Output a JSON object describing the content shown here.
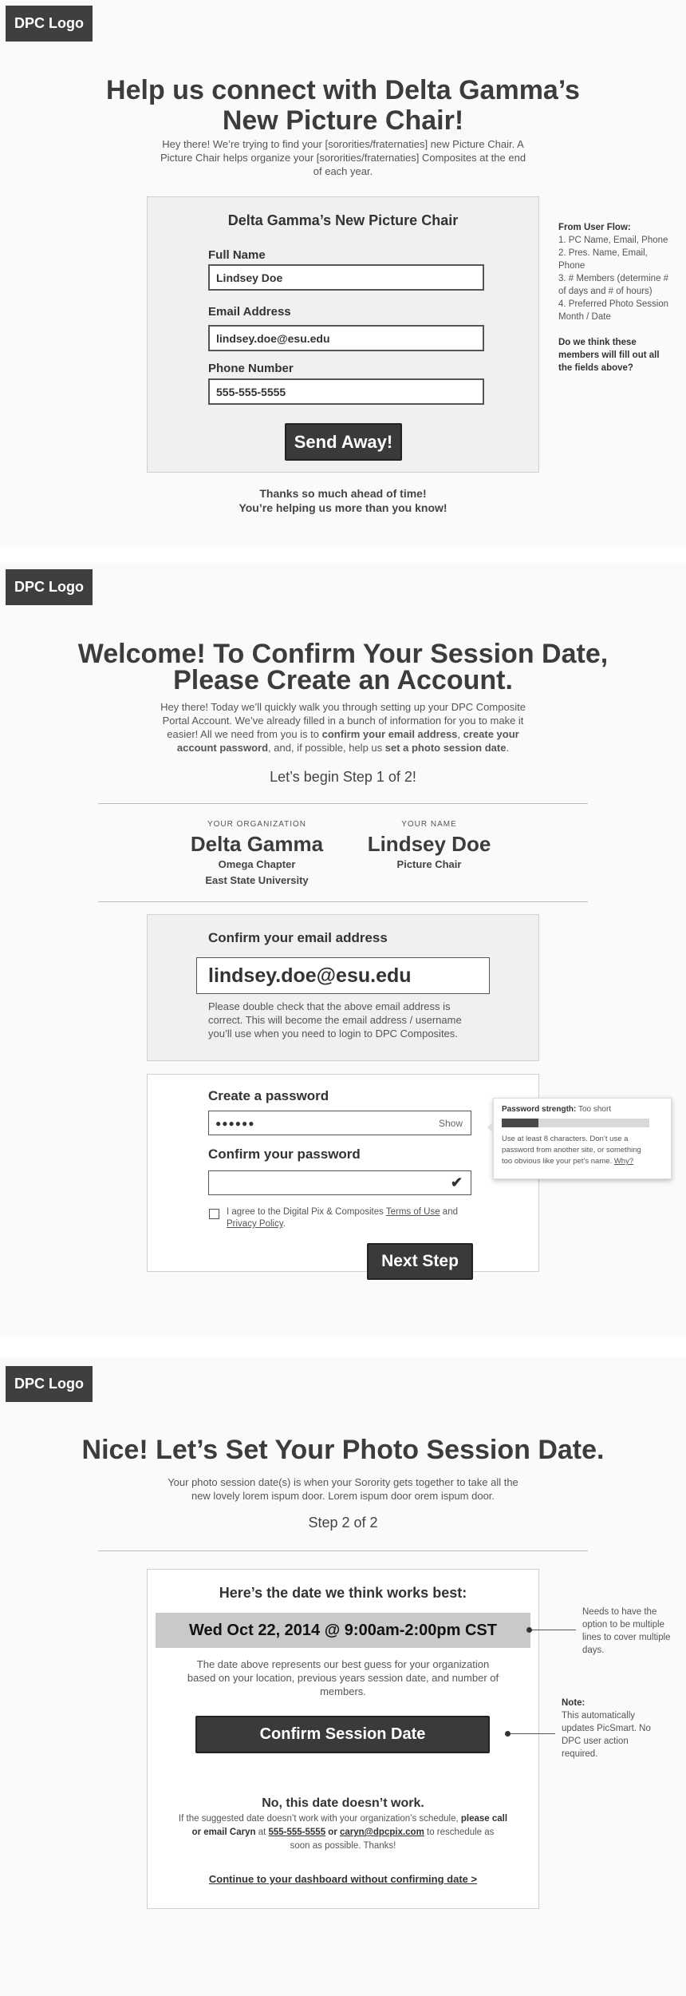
{
  "screen1": {
    "logo": "DPC Logo",
    "title_line1": "Help us connect with Delta Gamma’s",
    "title_line2": "New Picture Chair!",
    "intro_line1": "Hey there! We’re trying to find your [sororities/fraternaties] new Picture Chair. A",
    "intro_line2": "Picture Chair helps organize your [sororities/fraternaties] Composites at the end",
    "intro_line3": "of each year.",
    "form_heading": "Delta Gamma’s New Picture Chair",
    "full_name_label": "Full Name",
    "full_name_value": "Lindsey Doe",
    "email_label": "Email Address",
    "email_value": "lindsey.doe@esu.edu",
    "phone_label": "Phone Number",
    "phone_value": "555-555-5555",
    "send_button": "Send Away!",
    "thanks_line1": "Thanks so much ahead of time!",
    "thanks_line2": "You’re helping us more than you know!",
    "note_title": "From User Flow:",
    "note_lines": [
      "1. PC Name, Email, Phone",
      "2. Pres. Name, Email,",
      "Phone",
      "3. # Members (determine #",
      "of days and # of hours)",
      "4. Preferred Photo Session",
      "Month / Date"
    ],
    "note_question_lines": [
      "Do we think these",
      "members will fill out all",
      "the fields above?"
    ]
  },
  "screen2": {
    "logo": "DPC Logo",
    "title_line1": "Welcome! To Confirm Your Session Date,",
    "title_line2": "Please Create an Account.",
    "intro_line1": "Hey there! Today we’ll quickly walk you through setting up your DPC Composite",
    "intro_line2": "Portal Account. We’ve already filled in a bunch of information for you to make it",
    "intro_line3a": "easier! All we need from you is to ",
    "intro_line3b": "confirm your email address",
    "intro_line3c": ", ",
    "intro_line3d": "create your",
    "intro_line4a": "account password",
    "intro_line4b": ", and, if possible, help us ",
    "intro_line4c": "set a photo session date",
    "intro_line4d": ".",
    "step": "Let’s begin Step 1 of 2!",
    "org_caption": "YOUR ORGANIZATION",
    "org_name": "Delta Gamma",
    "org_chapter": "Omega Chapter",
    "org_school": "East State University",
    "name_caption": "YOUR NAME",
    "name_value": "Lindsey Doe",
    "name_role": "Picture Chair",
    "confirm_email_heading": "Confirm your email address",
    "confirm_email_value": "lindsey.doe@esu.edu",
    "confirm_email_help_line1": "Please double check that the above email address is",
    "confirm_email_help_line2": "correct. This will become the email address / username",
    "confirm_email_help_line3": "you’ll use when you need to login to DPC Composites.",
    "create_password_label": "Create a password",
    "password_mask": "●●●●●●",
    "show_label": "Show",
    "confirm_password_label": "Confirm your password",
    "check_mark": "✔",
    "agree_text_a": "I agree to the Digital Pix & Composites ",
    "terms_link": "Terms of Use",
    "agree_text_b": " and",
    "privacy_link": "Privacy Policy",
    "agree_text_c": ".",
    "next_button": "Next Step",
    "strength_label": "Password strength:",
    "strength_value": "Too short",
    "strength_fill": 0.25,
    "strength_help_line1": "Use at least 8 characters. Don’t use a",
    "strength_help_line2": "password from another site, or something",
    "strength_help_line3": "too obvious like your pet’s name. ",
    "why_link": "Why?"
  },
  "screen3": {
    "logo": "DPC Logo",
    "title": "Nice! Let’s Set Your Photo Session Date.",
    "intro_line1": "Your photo session date(s) is when your Sorority gets together to take all the",
    "intro_line2": "new lovely lorem ispum door. Lorem ispum door orem ispum door.",
    "step": "Step 2 of 2",
    "card_heading": "Here’s the date we think works best:",
    "date_value": "Wed Oct 22, 2014 @ 9:00am-2:00pm CST",
    "explain_line1": "The date above represents our best guess for your organization",
    "explain_line2": "based on your location, previous years session date, and number of",
    "explain_line3": "members.",
    "confirm_button": "Confirm Session Date",
    "no_heading": "No, this date doesn’t work.",
    "no_line1a": "If the suggested date doesn’t work with your organization’s schedule, ",
    "no_line1b": "please call",
    "no_line2a": "or email Caryn",
    "no_line2b": " at ",
    "phone_link": "555-555-5555",
    "no_line2c": " or ",
    "email_link": "caryn@dpcpix.com",
    "no_line2d": " to reschedule as",
    "no_line3": "soon as possible. Thanks!",
    "dashboard_link": "Continue to your dashboard without confirming date >",
    "note1_lines": [
      "Needs to have the",
      "option to be multiple",
      "lines to cover multiple",
      "days."
    ],
    "note2_title": "Note:",
    "note2_lines": [
      "This automatically",
      "updates PicSmart. No",
      "DPC user action",
      "required."
    ]
  }
}
